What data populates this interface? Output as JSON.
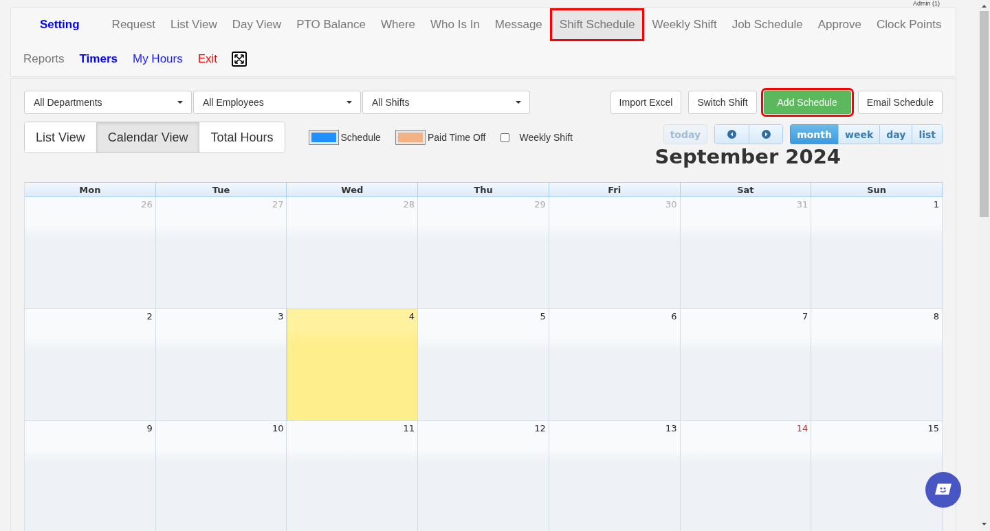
{
  "admin": "Admin (1)",
  "nav_top": [
    {
      "label": "Setting",
      "kind": "strong",
      "selected": false,
      "highlighted": false
    },
    {
      "label": "Request",
      "kind": "plain",
      "selected": false,
      "highlighted": false
    },
    {
      "label": "List View",
      "kind": "plain",
      "selected": false,
      "highlighted": false
    },
    {
      "label": "Day View",
      "kind": "plain",
      "selected": false,
      "highlighted": false
    },
    {
      "label": "PTO Balance",
      "kind": "plain",
      "selected": false,
      "highlighted": false
    },
    {
      "label": "Where",
      "kind": "plain",
      "selected": false,
      "highlighted": false
    },
    {
      "label": "Who Is In",
      "kind": "plain",
      "selected": false,
      "highlighted": false
    },
    {
      "label": "Message",
      "kind": "plain",
      "selected": false,
      "highlighted": false
    },
    {
      "label": "Shift Schedule",
      "kind": "plain",
      "selected": true,
      "highlighted": true
    },
    {
      "label": "Weekly Shift",
      "kind": "plain",
      "selected": false,
      "highlighted": false
    },
    {
      "label": "Job Schedule",
      "kind": "plain",
      "selected": false,
      "highlighted": false
    },
    {
      "label": "Approve",
      "kind": "plain",
      "selected": false,
      "highlighted": false
    },
    {
      "label": "Clock Points",
      "kind": "plain",
      "selected": false,
      "highlighted": false
    }
  ],
  "nav_bottom": [
    {
      "label": "Reports",
      "kind": "plain",
      "selected": false,
      "highlighted": false
    },
    {
      "label": "Timers",
      "kind": "strong",
      "selected": false,
      "highlighted": false
    },
    {
      "label": "My Hours",
      "kind": "link",
      "selected": false,
      "highlighted": false
    },
    {
      "label": "Exit",
      "kind": "danger",
      "selected": false,
      "highlighted": false
    },
    {
      "kind": "fullscreen",
      "selected": false,
      "highlighted": false
    }
  ],
  "filters": [
    {
      "value": "All Departments"
    },
    {
      "value": "All Employees"
    },
    {
      "value": "All Shifts"
    }
  ],
  "actions": [
    {
      "label": "Import Excel",
      "kind": "default",
      "highlighted": false
    },
    {
      "label": "Switch Shift",
      "kind": "default",
      "highlighted": false
    },
    {
      "label": "Add Schedule",
      "kind": "success",
      "highlighted": true
    },
    {
      "label": "Email Schedule",
      "kind": "default",
      "highlighted": false
    }
  ],
  "view_tabs": [
    {
      "label": "List View",
      "selected": false
    },
    {
      "label": "Calendar View",
      "selected": true
    },
    {
      "label": "Total Hours",
      "selected": false
    }
  ],
  "legend": [
    {
      "kind": "swatch",
      "label": "Schedule",
      "color": "#1e90ff"
    },
    {
      "kind": "swatch",
      "label": "Paid Time Off",
      "color": "#f4b183"
    },
    {
      "kind": "checkbox",
      "label": "Weekly Shift",
      "checked": false
    }
  ],
  "calendar": {
    "today": {
      "label": "today",
      "disabled": true
    },
    "views": [
      {
        "label": "month",
        "selected": true
      },
      {
        "label": "week",
        "selected": false
      },
      {
        "label": "day",
        "selected": false
      },
      {
        "label": "list",
        "selected": false
      }
    ],
    "title": "September 2024",
    "weekdays": [
      "Mon",
      "Tue",
      "Wed",
      "Thu",
      "Fri",
      "Sat",
      "Sun"
    ],
    "weeks": [
      [
        {
          "label": "26",
          "other_month": true,
          "today": false,
          "holiday": false
        },
        {
          "label": "27",
          "other_month": true,
          "today": false,
          "holiday": false
        },
        {
          "label": "28",
          "other_month": true,
          "today": false,
          "holiday": false
        },
        {
          "label": "29",
          "other_month": true,
          "today": false,
          "holiday": false
        },
        {
          "label": "30",
          "other_month": true,
          "today": false,
          "holiday": false
        },
        {
          "label": "31",
          "other_month": true,
          "today": false,
          "holiday": false
        },
        {
          "label": "1",
          "other_month": false,
          "today": false,
          "holiday": false
        }
      ],
      [
        {
          "label": "2",
          "other_month": false,
          "today": false,
          "holiday": false
        },
        {
          "label": "3",
          "other_month": false,
          "today": false,
          "holiday": false
        },
        {
          "label": "4",
          "other_month": false,
          "today": true,
          "holiday": false
        },
        {
          "label": "5",
          "other_month": false,
          "today": false,
          "holiday": false
        },
        {
          "label": "6",
          "other_month": false,
          "today": false,
          "holiday": false
        },
        {
          "label": "7",
          "other_month": false,
          "today": false,
          "holiday": false
        },
        {
          "label": "8",
          "other_month": false,
          "today": false,
          "holiday": false
        }
      ],
      [
        {
          "label": "9",
          "other_month": false,
          "today": false,
          "holiday": false
        },
        {
          "label": "10",
          "other_month": false,
          "today": false,
          "holiday": false
        },
        {
          "label": "11",
          "other_month": false,
          "today": false,
          "holiday": false
        },
        {
          "label": "12",
          "other_month": false,
          "today": false,
          "holiday": false
        },
        {
          "label": "13",
          "other_month": false,
          "today": false,
          "holiday": false
        },
        {
          "label": "14",
          "other_month": false,
          "today": false,
          "holiday": true
        },
        {
          "label": "15",
          "other_month": false,
          "today": false,
          "holiday": false
        }
      ]
    ]
  }
}
